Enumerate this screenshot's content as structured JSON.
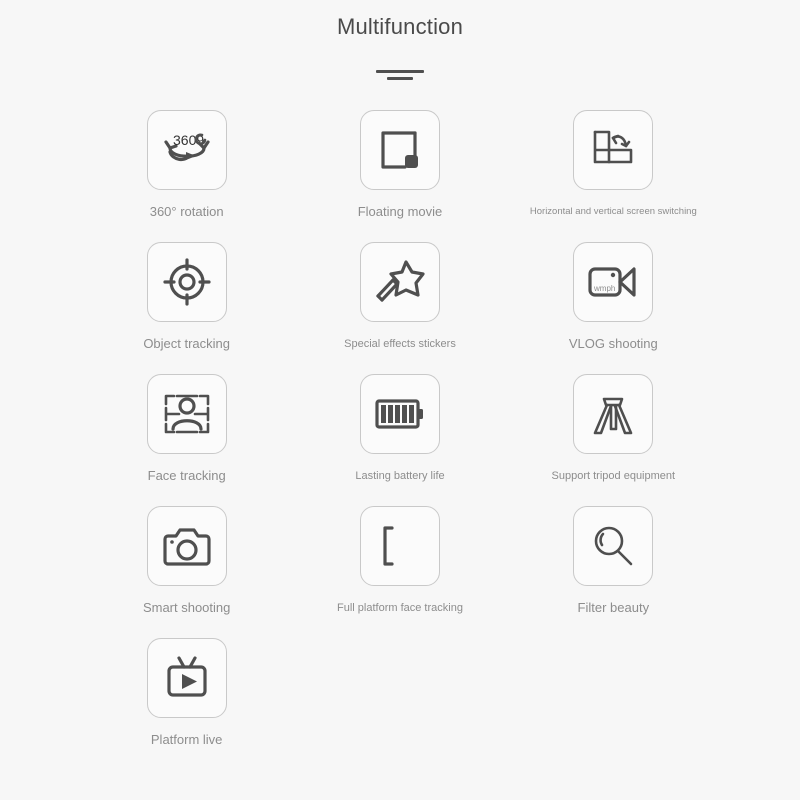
{
  "header": {
    "title": "Multifunction",
    "divider_wide": "divider-bar-wide",
    "divider_narrow": "divider-bar-narrow"
  },
  "colors": {
    "page_background": "#f7f7f7",
    "tile_background": "#fbfbfb",
    "tile_border": "#c9c9c9",
    "icon_stroke": "#4f4f4f",
    "label_text": "#8d8d8d",
    "title_text": "#4a4a4a"
  },
  "features": [
    {
      "id": "rotation-360",
      "label": "360° rotation",
      "icon": "rotation-360-icon",
      "label_size": "normal",
      "inner_text": "3609"
    },
    {
      "id": "floating-movie",
      "label": "Floating movie",
      "icon": "floating-movie-icon",
      "label_size": "normal"
    },
    {
      "id": "screen-switching",
      "label": "Horizontal and vertical screen switching",
      "icon": "screen-switching-icon",
      "label_size": "tiny"
    },
    {
      "id": "object-tracking",
      "label": "Object tracking",
      "icon": "crosshair-icon",
      "label_size": "normal"
    },
    {
      "id": "special-effects",
      "label": "Special effects stickers",
      "icon": "magic-wand-icon",
      "label_size": "small"
    },
    {
      "id": "vlog-shooting",
      "label": "VLOG shooting",
      "icon": "video-camera-icon",
      "label_size": "normal",
      "inner_text": "wmph"
    },
    {
      "id": "face-tracking",
      "label": "Face tracking",
      "icon": "face-tracking-icon",
      "label_size": "normal"
    },
    {
      "id": "battery-life",
      "label": "Lasting battery life",
      "icon": "battery-icon",
      "label_size": "small"
    },
    {
      "id": "tripod-support",
      "label": "Support tripod equipment",
      "icon": "tripod-icon",
      "label_size": "small"
    },
    {
      "id": "smart-shooting",
      "label": "Smart shooting",
      "icon": "camera-icon",
      "label_size": "normal"
    },
    {
      "id": "full-face-tracking",
      "label": "Full platform face tracking",
      "icon": "bracket-icon",
      "label_size": "small"
    },
    {
      "id": "filter-beauty",
      "label": "Filter beauty",
      "icon": "magnifier-icon",
      "label_size": "normal"
    },
    {
      "id": "platform-live",
      "label": "Platform live",
      "icon": "tv-play-icon",
      "label_size": "normal"
    }
  ]
}
